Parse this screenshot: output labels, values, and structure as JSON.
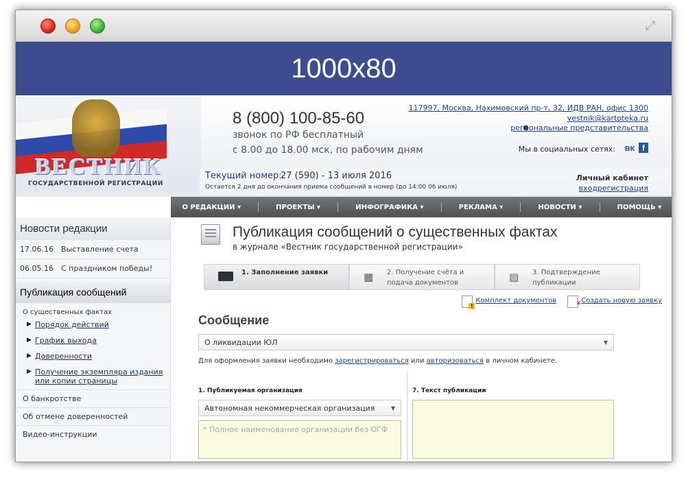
{
  "banner": {
    "text": "1000x80"
  },
  "header": {
    "logo_title": "ВЕСТНИК",
    "logo_subtitle": "ГОСУДАРСТВЕННОЙ РЕГИСТРАЦИИ",
    "phone": "8 (800) 100-85-60",
    "phone_note_1": "звонок по РФ бесплатный",
    "phone_note_2": "с 8.00 до 18.00 мск, по рабочим дням",
    "address": "117997, Москва, Нахимовский пр-т, 32, ИДВ РАН, офис 1300",
    "email": "vestnik@kartoteka.ru",
    "regions": "региональные представительства",
    "social_label": "Мы в социальных сетях:",
    "vk_icon": "вк",
    "fb_icon": "f",
    "issue_label": "Текущий номер:",
    "issue_value": "27 (590) - 13 июля 2016",
    "issue_note": "Остается 2 дня до окончания приема сообщений в номер (до 14:00 06 июля)",
    "cabinet_label": "Личный кабинет",
    "login": "вход",
    "register": "регистрация"
  },
  "nav": {
    "items": [
      "О РЕДАКЦИИ ▾",
      "ПРОЕКТЫ ▾",
      "ИНФОГРАФИКА ▾",
      "РЕКЛАМА ▾",
      "НОВОСТИ ▾",
      "ПОМОЩЬ ▾"
    ]
  },
  "sidebar": {
    "news_title": "Новости редакции",
    "news": [
      {
        "date": "17.06.16",
        "title": "Выставление счета"
      },
      {
        "date": "06.05.16",
        "title": "С праздником победы!"
      }
    ],
    "pub_title": "Публикация сообщений",
    "pub_sub": "О существенных фактах",
    "pub_items": [
      "Порядок действий",
      "График выхода",
      "Доверенности",
      "Получение экземпляра издания или копии страницы"
    ],
    "links": [
      "О банкротстве",
      "Об отмене доверенностей",
      "Видео-инструкции"
    ]
  },
  "main": {
    "title": "Публикация сообщений о существенных фактах",
    "subtitle": "в журнале «Вестник государственной регистрации»",
    "steps": [
      {
        "label": "1. Заполнение заявки"
      },
      {
        "label": "2. Получение счёта и подача документов"
      },
      {
        "label": "3. Подтверждение публикации"
      }
    ],
    "doc_kit_link": "Комплект документов",
    "new_request_link": "Создать новую заявку",
    "message_title": "Сообщение",
    "message_select": "О ликвидации ЮЛ",
    "info_prefix": "Для оформления заявки необходимо ",
    "info_register": "зарегистрироваться",
    "info_or": " или ",
    "info_login": "авторизоваться",
    "info_suffix": " в личном кабинете.",
    "org_label": "1. Публикуемая организация",
    "org_select": "Автономная некоммерческая организация",
    "org_name_placeholder": "* Полное наименование организации без ОГФ",
    "pub_text_label": "7. Текст публикации"
  }
}
